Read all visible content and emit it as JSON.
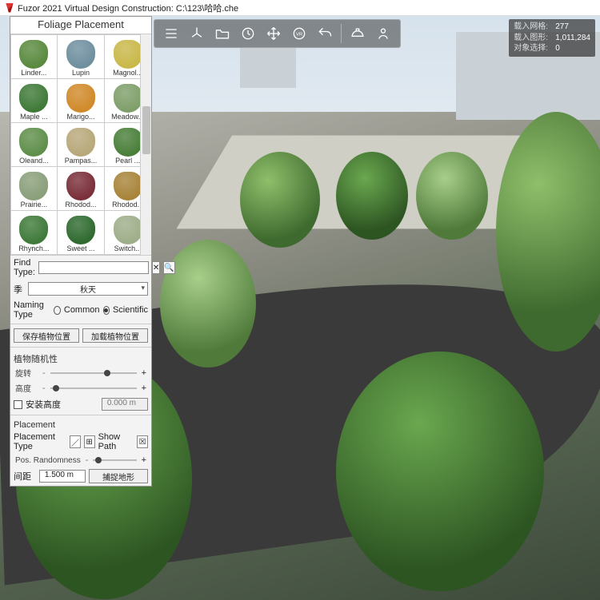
{
  "title": "Fuzor 2021 Virtual Design Construction: C:\\123\\哈哈.che",
  "panel": {
    "title": "Foliage Placement",
    "thumbs": [
      {
        "label": "Linder...",
        "color": "#5a8a3f"
      },
      {
        "label": "Lupin",
        "color": "#6f8f9f"
      },
      {
        "label": "Magnol...",
        "color": "#c9b84a"
      },
      {
        "label": "Maple ...",
        "color": "#3f7a38"
      },
      {
        "label": "Marigo...",
        "color": "#d08a2a"
      },
      {
        "label": "Meadow...",
        "color": "#7f9f6a"
      },
      {
        "label": "Oleand...",
        "color": "#5f8f4a"
      },
      {
        "label": "Pampas...",
        "color": "#b8a87a"
      },
      {
        "label": "Pearl ...",
        "color": "#4a7f3a"
      },
      {
        "label": "Prairie...",
        "color": "#8a9f7a"
      },
      {
        "label": "Rhodod...",
        "color": "#7a2f3a"
      },
      {
        "label": "Rhodod...",
        "color": "#a8843a"
      },
      {
        "label": "Rhynch...",
        "color": "#3f7a3a"
      },
      {
        "label": "Sweet ...",
        "color": "#2f6a2f"
      },
      {
        "label": "Switch...",
        "color": "#9fae8a"
      }
    ],
    "find_label": "Find Type:",
    "find_value": "",
    "season_label": "季",
    "season_value": "秋天",
    "naming_label": "Naming Type",
    "naming_common": "Common",
    "naming_scientific": "Scientific",
    "naming_selected": "scientific",
    "save_btn": "保存植物位置",
    "load_btn": "加载植物位置",
    "randomness_title": "植物随机性",
    "rotation_label": "旋转",
    "height_label": "高度",
    "install_height_label": "安装高度",
    "install_height_value": "0.000 m",
    "placement_title": "Placement",
    "placement_type_label": "Placement Type",
    "show_path_label": "Show Path",
    "pos_randomness_label": "Pos. Randomness",
    "spacing_label": "间距",
    "spacing_value": "1.500 m",
    "capture_terrain_btn": "捕捉地形"
  },
  "toolbar": {
    "items": [
      "menu",
      "axes",
      "open",
      "clock",
      "move",
      "vr",
      "undo",
      "hardhat",
      "person"
    ]
  },
  "stats": {
    "rows": [
      {
        "k": "载入网格:",
        "v": "277"
      },
      {
        "k": "载入图形:",
        "v": "1,011,284"
      },
      {
        "k": "对象选择:",
        "v": "0"
      }
    ]
  }
}
